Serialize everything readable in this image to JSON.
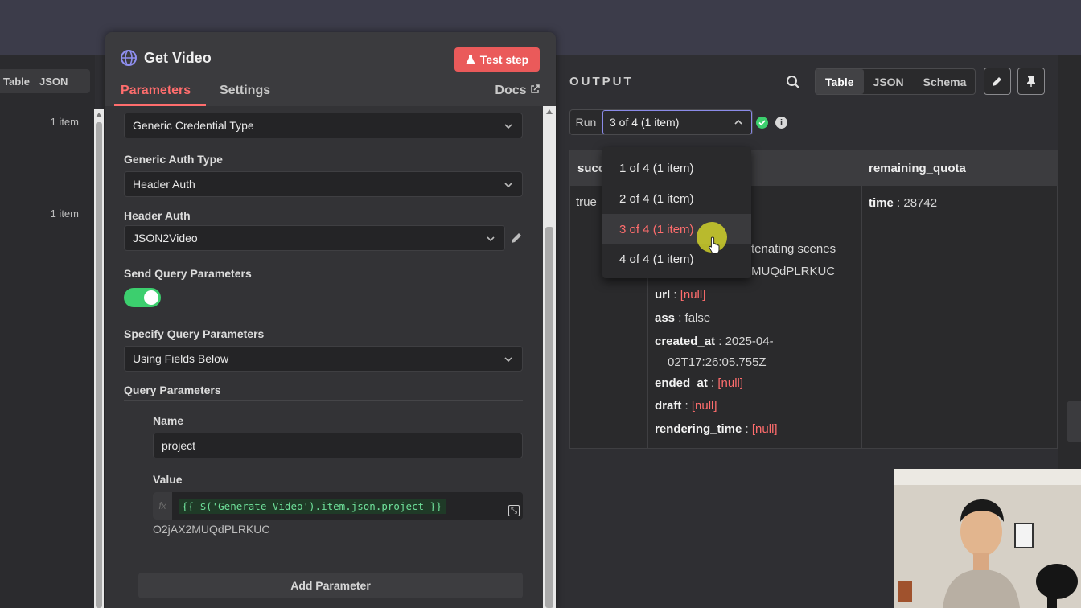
{
  "left_panel": {
    "tabs": [
      "Table",
      "JSON"
    ],
    "items": [
      "1 item",
      "1 item"
    ]
  },
  "node": {
    "icon": "globe-icon",
    "title": "Get Video",
    "test_step_label": "Test step",
    "tabs": {
      "parameters": "Parameters",
      "settings": "Settings"
    },
    "docs_label": "Docs",
    "fields": {
      "credential_type": {
        "value": "Generic Credential Type"
      },
      "generic_auth_type": {
        "label": "Generic Auth Type",
        "value": "Header Auth"
      },
      "header_auth": {
        "label": "Header Auth",
        "value": "JSON2Video"
      },
      "send_query": {
        "label": "Send Query Parameters",
        "enabled": true
      },
      "specify_query": {
        "label": "Specify Query Parameters",
        "value": "Using Fields Below"
      },
      "query_params": {
        "label": "Query Parameters"
      },
      "name": {
        "label": "Name",
        "value": "project"
      },
      "value": {
        "label": "Value",
        "fx": "fx",
        "expression": "{{ $('Generate Video').item.json.project }}",
        "resolved": "O2jAX2MUQdPLRKUC"
      }
    },
    "add_parameter_label": "Add Parameter"
  },
  "output": {
    "title": "OUTPUT",
    "view_tabs": [
      "Table",
      "JSON",
      "Schema"
    ],
    "active_view": "Table",
    "run_label": "Run",
    "run_selected": "3 of 4 (1 item)",
    "run_options": [
      "1 of 4 (1 item)",
      "2 of 4 (1 item)",
      "3 of 4 (1 item)",
      "4 of 4 (1 item)"
    ],
    "columns": {
      "c1": "succ",
      "c3": "remaining_quota"
    },
    "row": {
      "success": "true",
      "partial_1": "tenating scenes",
      "partial_2": "MUQdPLRKUC",
      "url_key": "url",
      "url_val": "[null]",
      "ass_key": "ass",
      "ass_val": "false",
      "created_key": "created_at",
      "created_val_1": "2025-04-",
      "created_val_2": "02T17:26:05.755Z",
      "ended_key": "ended_at",
      "ended_val": "[null]",
      "draft_key": "draft",
      "draft_val": "[null]",
      "rendering_key": "rendering_time",
      "rendering_val": "[null]",
      "time_key": "time",
      "time_val": "28742"
    }
  },
  "colors": {
    "accent": "#ff6d6d",
    "test_button": "#ea5a5a",
    "toggle_on": "#3ccf6e",
    "null": "#ff6d6d"
  }
}
